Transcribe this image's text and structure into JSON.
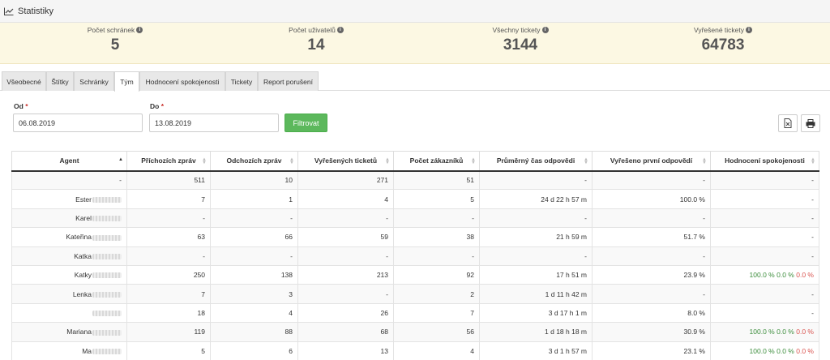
{
  "header": {
    "title": "Statistiky",
    "icon": "line-chart-icon"
  },
  "stats": [
    {
      "label": "Počet schránek",
      "value": "5"
    },
    {
      "label": "Počet uživatelů",
      "value": "14"
    },
    {
      "label": "Všechny tickety",
      "value": "3144"
    },
    {
      "label": "Vyřešené tickety",
      "value": "64783"
    }
  ],
  "tabs": [
    "Všeobecné",
    "Štítky",
    "Schránky",
    "Tým",
    "Hodnocení spokojenosti",
    "Tickety",
    "Report porušení"
  ],
  "active_tab": "Tým",
  "filter": {
    "from_label": "Od",
    "from_value": "06.08.2019",
    "to_label": "Do",
    "to_value": "13.08.2019",
    "required_mark": "*",
    "button_label": "Filtrovat"
  },
  "table": {
    "columns": [
      "Agent",
      "Příchozích zpráv",
      "Odchozích zpráv",
      "Vyřešených ticketů",
      "Počet zákazníků",
      "Průměrný čas odpovědi",
      "Vyřešeno první odpovědí",
      "Hodnocení spokojenosti"
    ],
    "rows": [
      {
        "agent": "-",
        "incoming": "511",
        "outgoing": "10",
        "resolved": "271",
        "customers": "51",
        "avg_time": "-",
        "first_reply": "-",
        "satisfaction": "-"
      },
      {
        "agent": "Ester",
        "incoming": "7",
        "outgoing": "1",
        "resolved": "4",
        "customers": "5",
        "avg_time": "24 d 22 h 57 m",
        "first_reply": "100.0 %",
        "satisfaction": "-"
      },
      {
        "agent": "Karel",
        "incoming": "-",
        "outgoing": "-",
        "resolved": "-",
        "customers": "-",
        "avg_time": "-",
        "first_reply": "-",
        "satisfaction": "-"
      },
      {
        "agent": "Kateřina",
        "incoming": "63",
        "outgoing": "66",
        "resolved": "59",
        "customers": "38",
        "avg_time": "21 h 59 m",
        "first_reply": "51.7 %",
        "satisfaction": "-"
      },
      {
        "agent": "Katka",
        "incoming": "-",
        "outgoing": "-",
        "resolved": "-",
        "customers": "-",
        "avg_time": "-",
        "first_reply": "-",
        "satisfaction": "-"
      },
      {
        "agent": "Katky",
        "incoming": "250",
        "outgoing": "138",
        "resolved": "213",
        "customers": "92",
        "avg_time": "17 h 51 m",
        "first_reply": "23.9 %",
        "satisfaction": [
          "100.0 %",
          "0.0 %",
          "0.0 %"
        ]
      },
      {
        "agent": "Lenka",
        "incoming": "7",
        "outgoing": "3",
        "resolved": "-",
        "customers": "2",
        "avg_time": "1 d 11 h 42 m",
        "first_reply": "-",
        "satisfaction": "-"
      },
      {
        "agent": "",
        "incoming": "18",
        "outgoing": "4",
        "resolved": "26",
        "customers": "7",
        "avg_time": "3 d 17 h 1 m",
        "first_reply": "8.0 %",
        "satisfaction": "-"
      },
      {
        "agent": "Mariana",
        "incoming": "119",
        "outgoing": "88",
        "resolved": "68",
        "customers": "56",
        "avg_time": "1 d 18 h 18 m",
        "first_reply": "30.9 %",
        "satisfaction": [
          "100.0 %",
          "0.0 %",
          "0.0 %"
        ]
      },
      {
        "agent": "Ma",
        "incoming": "5",
        "outgoing": "6",
        "resolved": "13",
        "customers": "4",
        "avg_time": "3 d 1 h 57 m",
        "first_reply": "23.1 %",
        "satisfaction": [
          "100.0 %",
          "0.0 %",
          "0.0 %"
        ]
      }
    ]
  },
  "colors": {
    "stats_bg": "#fcf8e3",
    "filter_button": "#5cb85c",
    "positive": "#3c8d3c",
    "negative": "#d9534f"
  }
}
